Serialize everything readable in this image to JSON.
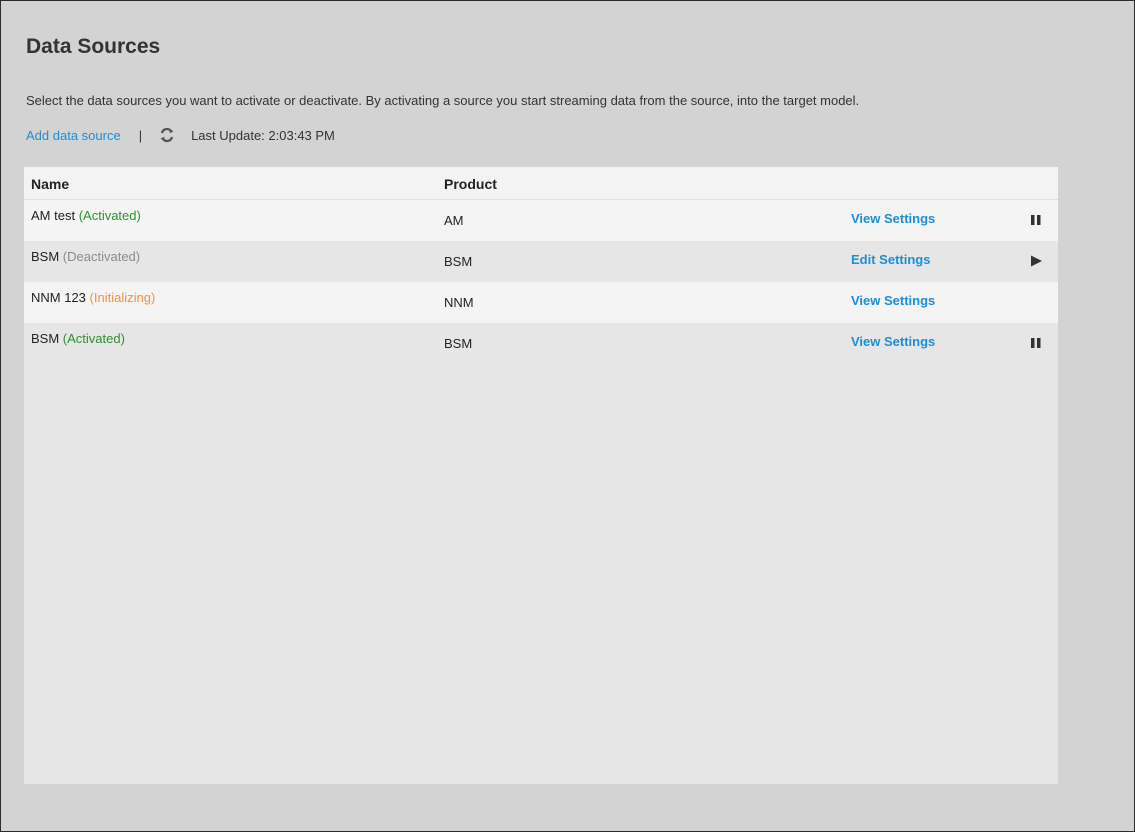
{
  "page": {
    "title": "Data Sources",
    "description": "Select the data sources you want to activate or deactivate. By activating a source you start streaming data from the source, into the target model."
  },
  "toolbar": {
    "add_link": "Add data source",
    "separator": "|",
    "refresh_icon": "refresh-icon",
    "last_update": "Last Update: 2:03:43 PM"
  },
  "table": {
    "columns": [
      "Name",
      "Product",
      "",
      ""
    ],
    "rows": [
      {
        "name": "AM test",
        "status": "(Activated)",
        "status_color": "#2f8f2f",
        "product": "AM",
        "action": "View Settings",
        "control_icon": "pause-icon"
      },
      {
        "name": "BSM",
        "status": "(Deactivated)",
        "status_color": "#8c8c8c",
        "product": "BSM",
        "action": "Edit Settings",
        "control_icon": "play-icon"
      },
      {
        "name": "NNM 123",
        "status": "(Initializing)",
        "status_color": "#f39237",
        "product": "NNM",
        "action": "View Settings",
        "control_icon": ""
      },
      {
        "name": "BSM",
        "status": "(Activated)",
        "status_color": "#2f8f2f",
        "product": "BSM",
        "action": "View Settings",
        "control_icon": "pause-icon"
      }
    ]
  },
  "colors": {
    "link": "#1a8fd4",
    "activated": "#2f8f2f",
    "deactivated": "#8c8c8c",
    "initializing": "#f39237"
  }
}
